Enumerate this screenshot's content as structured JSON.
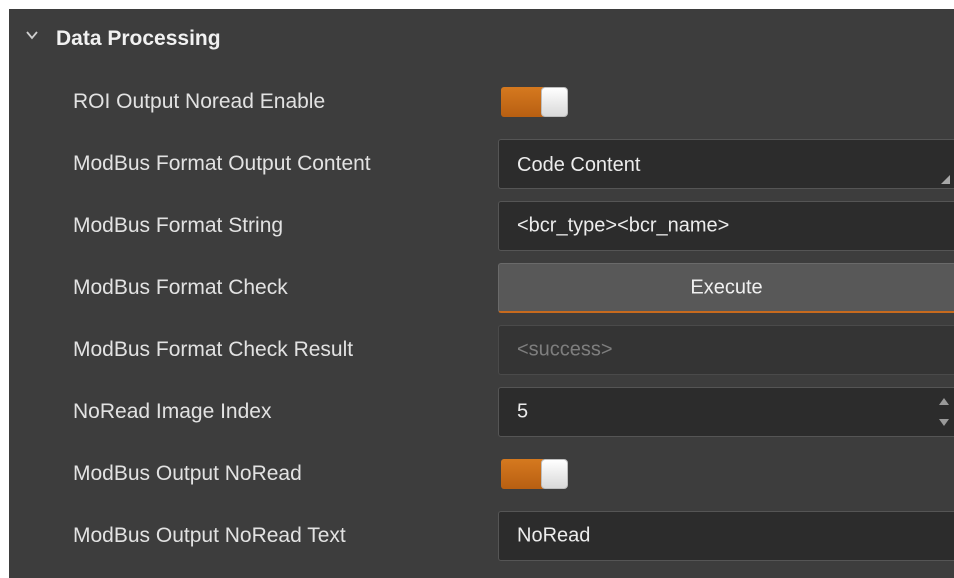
{
  "section": {
    "title": "Data Processing",
    "expanded": true
  },
  "rows": {
    "roi_output_noread_enable": {
      "label": "ROI Output Noread Enable",
      "value": true
    },
    "modbus_format_output_content": {
      "label": "ModBus Format Output Content",
      "value": "Code Content"
    },
    "modbus_format_string": {
      "label": "ModBus Format String",
      "value": "<bcr_type><bcr_name>"
    },
    "modbus_format_check": {
      "label": "ModBus Format Check",
      "button_label": "Execute"
    },
    "modbus_format_check_result": {
      "label": "ModBus Format Check Result",
      "value": "<success>"
    },
    "noread_image_index": {
      "label": "NoRead Image Index",
      "value": "5"
    },
    "modbus_output_noread": {
      "label": "ModBus Output NoRead",
      "value": true
    },
    "modbus_output_noread_text": {
      "label": "ModBus Output NoRead Text",
      "value": "NoRead"
    }
  },
  "colors": {
    "panel_bg": "#3d3d3d",
    "input_bg": "#2c2c2c",
    "accent_orange": "#d5791f",
    "label_text": "#e2e2e2"
  },
  "icons": {
    "collapse": "chevron-down-icon",
    "resize": "resize-grip-icon",
    "spin_up": "spin-up-icon",
    "spin_down": "spin-down-icon"
  }
}
